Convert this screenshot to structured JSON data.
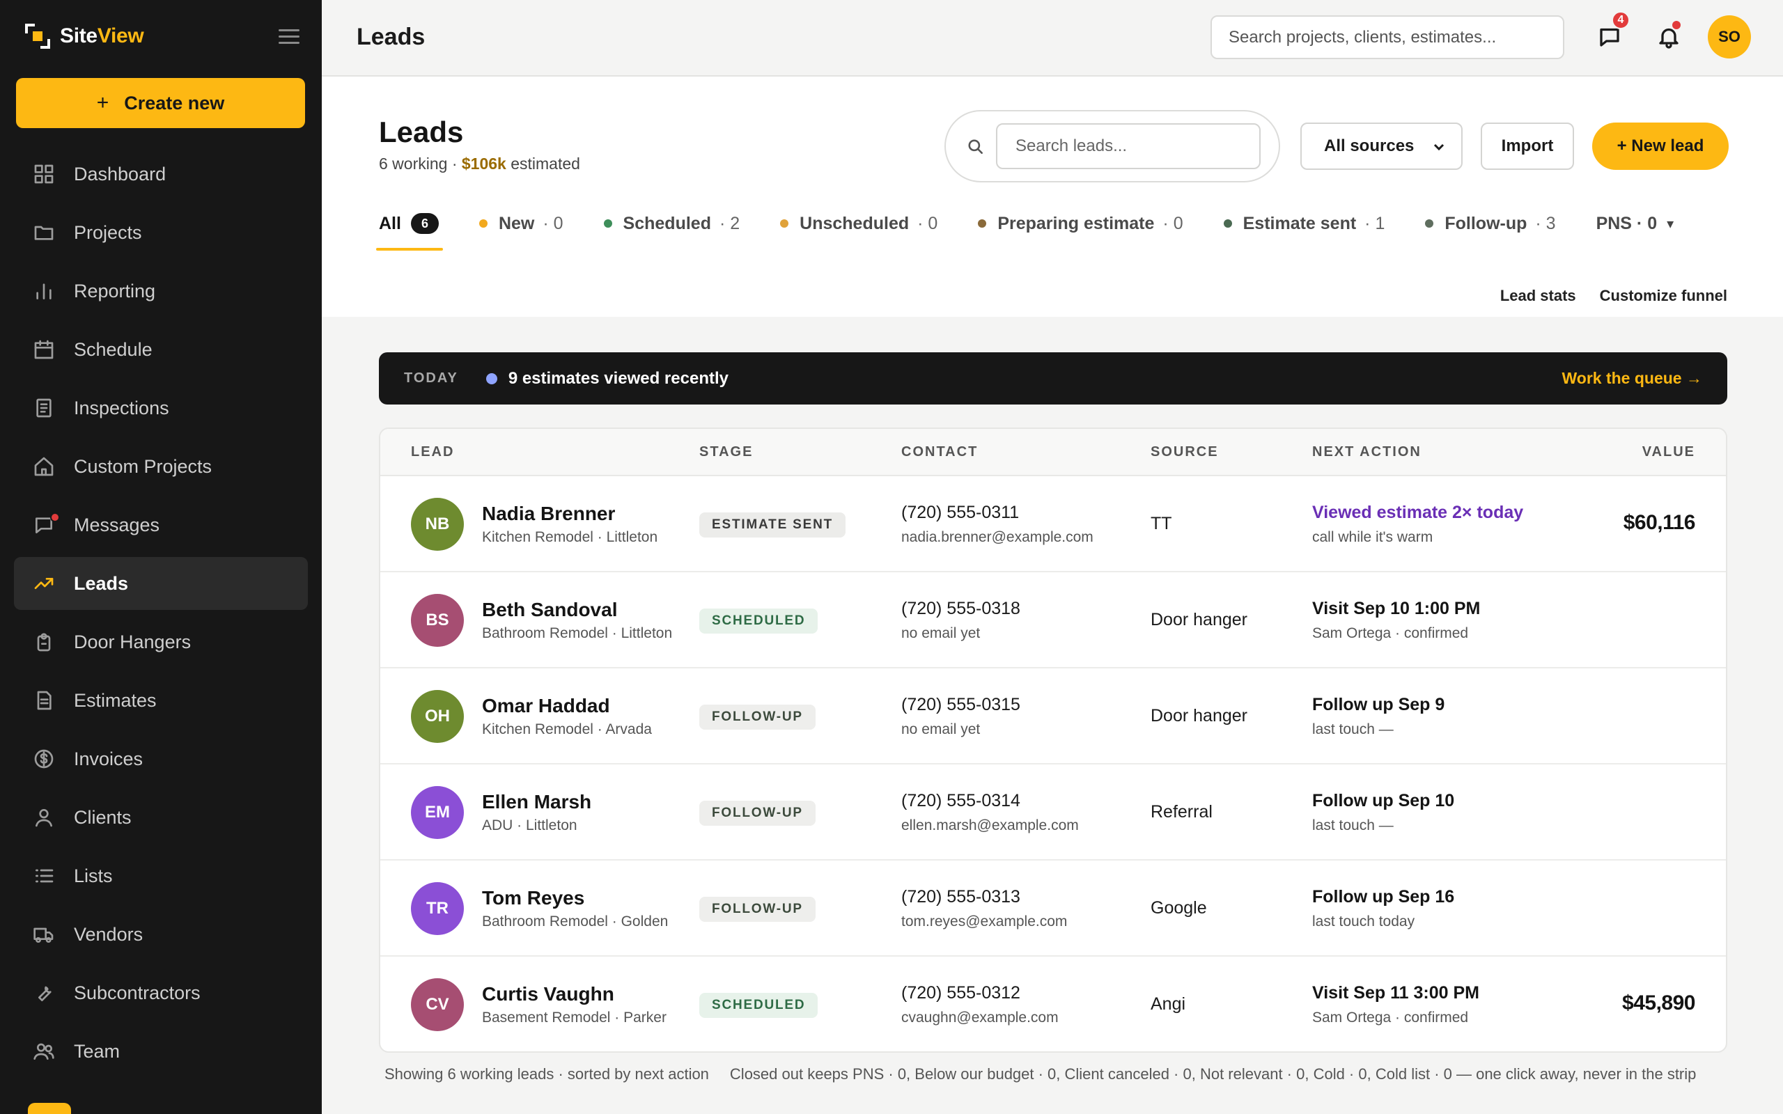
{
  "app": {
    "brand_prefix": "Site",
    "brand_suffix": "View",
    "create_label": "Create new",
    "create_plus": "+"
  },
  "nav": [
    {
      "label": "Dashboard",
      "icon": "dashboard-icon"
    },
    {
      "label": "Projects",
      "icon": "folder-icon"
    },
    {
      "label": "Reporting",
      "icon": "bar-chart-icon"
    },
    {
      "label": "Schedule",
      "icon": "calendar-icon"
    },
    {
      "label": "Inspections",
      "icon": "clipboard-icon"
    },
    {
      "label": "Custom Projects",
      "icon": "home-icon"
    },
    {
      "label": "Messages",
      "icon": "chat-icon"
    },
    {
      "label": "Leads",
      "icon": "trending-up-icon",
      "active": true
    },
    {
      "label": "Door Hangers",
      "icon": "door-hanger-icon"
    },
    {
      "label": "Estimates",
      "icon": "document-icon"
    },
    {
      "label": "Invoices",
      "icon": "dollar-circle-icon"
    },
    {
      "label": "Clients",
      "icon": "user-icon"
    },
    {
      "label": "Lists",
      "icon": "list-icon"
    },
    {
      "label": "Vendors",
      "icon": "truck-icon"
    },
    {
      "label": "Subcontractors",
      "icon": "wrench-icon"
    },
    {
      "label": "Team",
      "icon": "users-icon"
    }
  ],
  "topbar": {
    "title": "Leads",
    "search_placeholder": "Search projects, clients, estimates...",
    "messages_count": "4",
    "user_initials": "SO"
  },
  "header": {
    "title": "Leads",
    "sub_working": "6 working · ",
    "sub_money": "$106k",
    "sub_suffix": " estimated",
    "search_placeholder": "Search leads...",
    "source_selected": "All sources",
    "import_label": "Import",
    "new_lead_label": "+ New lead",
    "lead_stats_label": "Lead stats",
    "customize_label": "Customize funnel"
  },
  "tabs": [
    {
      "label": "All",
      "count": "6",
      "active": true
    },
    {
      "label": "New",
      "count": "· 0",
      "color": "#F2A91E"
    },
    {
      "label": "Scheduled",
      "count": "· 2",
      "color": "#3E8E5A"
    },
    {
      "label": "Unscheduled",
      "count": "· 0",
      "color": "#E0A23A"
    },
    {
      "label": "Preparing estimate",
      "count": "· 0",
      "color": "#8A6A3A"
    },
    {
      "label": "Estimate sent",
      "count": "· 1",
      "color": "#4A6A52"
    },
    {
      "label": "Follow-up",
      "count": "· 3",
      "color": "#5F6E5F"
    },
    {
      "label": "PNS · 0",
      "count": "▾"
    }
  ],
  "today": {
    "label": "TODAY",
    "text": "9 estimates viewed recently",
    "link": "Work the queue →"
  },
  "table": {
    "headers": {
      "lead": "LEAD",
      "stage": "STAGE",
      "contact": "CONTACT",
      "source": "SOURCE",
      "next_action": "NEXT ACTION",
      "value": "VALUE"
    },
    "rows": [
      {
        "initials": "NB",
        "avatar_color": "#6E8B2F",
        "name": "Nadia Brenner",
        "meta": "Kitchen Remodel · Littleton",
        "stage": "ESTIMATE SENT",
        "stage_kind": "sent",
        "phone": "(720) 555-0311",
        "email": "nadia.brenner@example.com",
        "source": "TT",
        "action": "Viewed estimate 2× today",
        "action_hot": true,
        "action_sub": "call while it's warm",
        "value": "$60,116"
      },
      {
        "initials": "BS",
        "avatar_color": "#A64E72",
        "name": "Beth Sandoval",
        "meta": "Bathroom Remodel · Littleton",
        "stage": "SCHEDULED",
        "stage_kind": "scheduled",
        "phone": "(720) 555-0318",
        "email": "no email yet",
        "source": "Door hanger",
        "action": "Visit Sep 10 1:00 PM",
        "action_hot": false,
        "action_sub": "Sam Ortega · confirmed",
        "value": ""
      },
      {
        "initials": "OH",
        "avatar_color": "#6E8B2F",
        "name": "Omar Haddad",
        "meta": "Kitchen Remodel · Arvada",
        "stage": "FOLLOW-UP",
        "stage_kind": "followup",
        "phone": "(720) 555-0315",
        "email": "no email yet",
        "source": "Door hanger",
        "action": "Follow up Sep 9",
        "action_hot": false,
        "action_sub": "last touch —",
        "value": ""
      },
      {
        "initials": "EM",
        "avatar_color": "#8B4FD6",
        "name": "Ellen Marsh",
        "meta": "ADU · Littleton",
        "stage": "FOLLOW-UP",
        "stage_kind": "followup",
        "phone": "(720) 555-0314",
        "email": "ellen.marsh@example.com",
        "source": "Referral",
        "action": "Follow up Sep 10",
        "action_hot": false,
        "action_sub": "last touch —",
        "value": ""
      },
      {
        "initials": "TR",
        "avatar_color": "#8B4FD6",
        "name": "Tom Reyes",
        "meta": "Bathroom Remodel · Golden",
        "stage": "FOLLOW-UP",
        "stage_kind": "followup",
        "phone": "(720) 555-0313",
        "email": "tom.reyes@example.com",
        "source": "Google",
        "action": "Follow up Sep 16",
        "action_hot": false,
        "action_sub": "last touch today",
        "value": ""
      },
      {
        "initials": "CV",
        "avatar_color": "#A64E72",
        "name": "Curtis Vaughn",
        "meta": "Basement Remodel · Parker",
        "stage": "SCHEDULED",
        "stage_kind": "scheduled",
        "phone": "(720) 555-0312",
        "email": "cvaughn@example.com",
        "source": "Angi",
        "action": "Visit Sep 11 3:00 PM",
        "action_hot": false,
        "action_sub": "Sam Ortega · confirmed",
        "value": "$45,890"
      }
    ]
  },
  "footer": {
    "left": "Showing 6 working leads · sorted by next action",
    "right": "Closed out keeps PNS · 0, Below our budget · 0, Client canceled · 0, Not relevant · 0, Cold · 0, Cold list · 0 — one click away, never in the strip"
  }
}
